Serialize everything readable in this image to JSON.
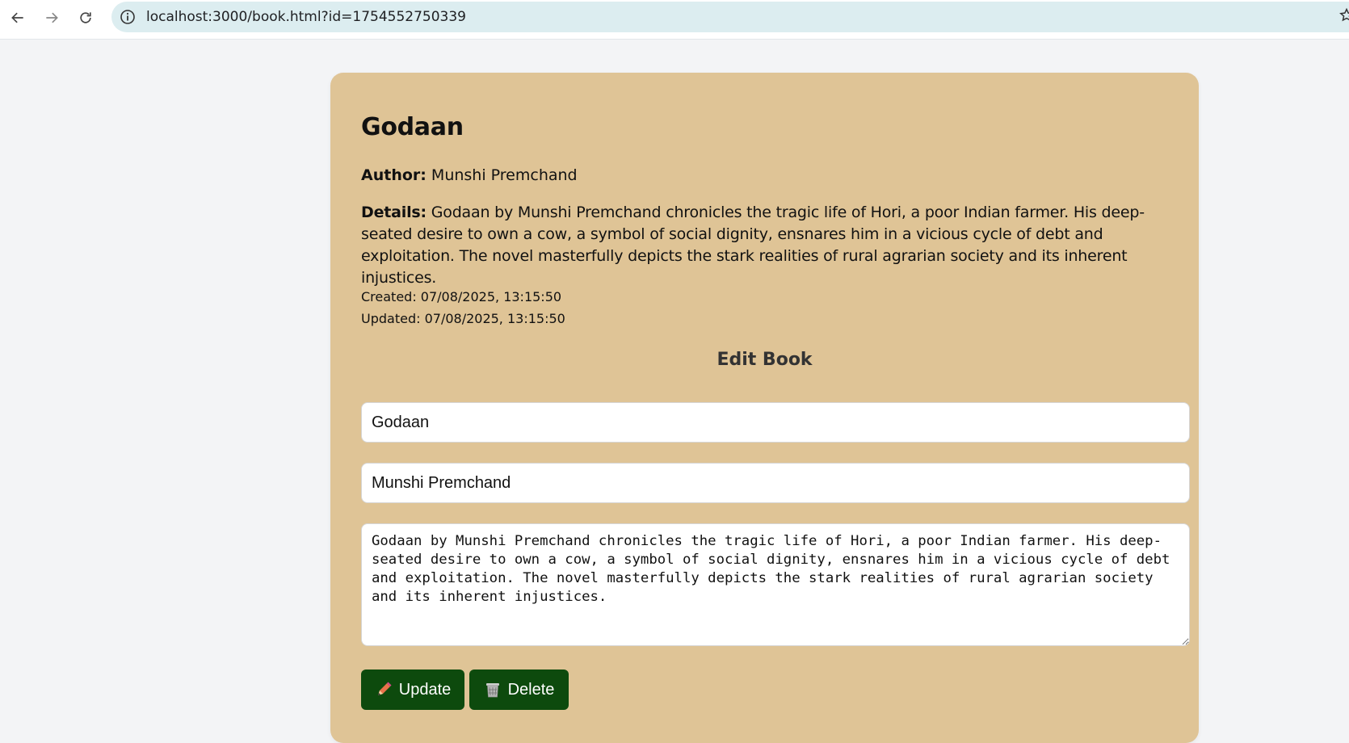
{
  "browser": {
    "url": "localhost:3000/book.html?id=1754552750339"
  },
  "book": {
    "title": "Godaan",
    "author_label": "Author:",
    "author": "Munshi Premchand",
    "details_label": "Details:",
    "details": "Godaan by Munshi Premchand chronicles the tragic life of Hori, a poor Indian farmer. His deep-seated desire to own a cow, a symbol of social dignity, ensnares him in a vicious cycle of debt and exploitation. The novel masterfully depicts the stark realities of rural agrarian society and its inherent injustices.",
    "created": "Created: 07/08/2025, 13:15:50",
    "updated": "Updated: 07/08/2025, 13:15:50"
  },
  "edit_form": {
    "heading": "Edit Book",
    "title_value": "Godaan",
    "author_value": "Munshi Premchand",
    "details_value": "Godaan by Munshi Premchand chronicles the tragic life of Hori, a poor Indian farmer. His deep-seated desire to own a cow, a symbol of social dignity, ensnares him in a vicious cycle of debt and exploitation. The novel masterfully depicts the stark realities of rural agrarian society and its inherent injustices.",
    "update_label": "Update",
    "delete_label": "Delete"
  },
  "icons": {
    "update": "pencil-icon",
    "delete": "wastebasket-icon"
  },
  "colors": {
    "card_background": "#dfc496",
    "button_background": "#0d4a0d",
    "page_background": "#f3f4f6"
  }
}
